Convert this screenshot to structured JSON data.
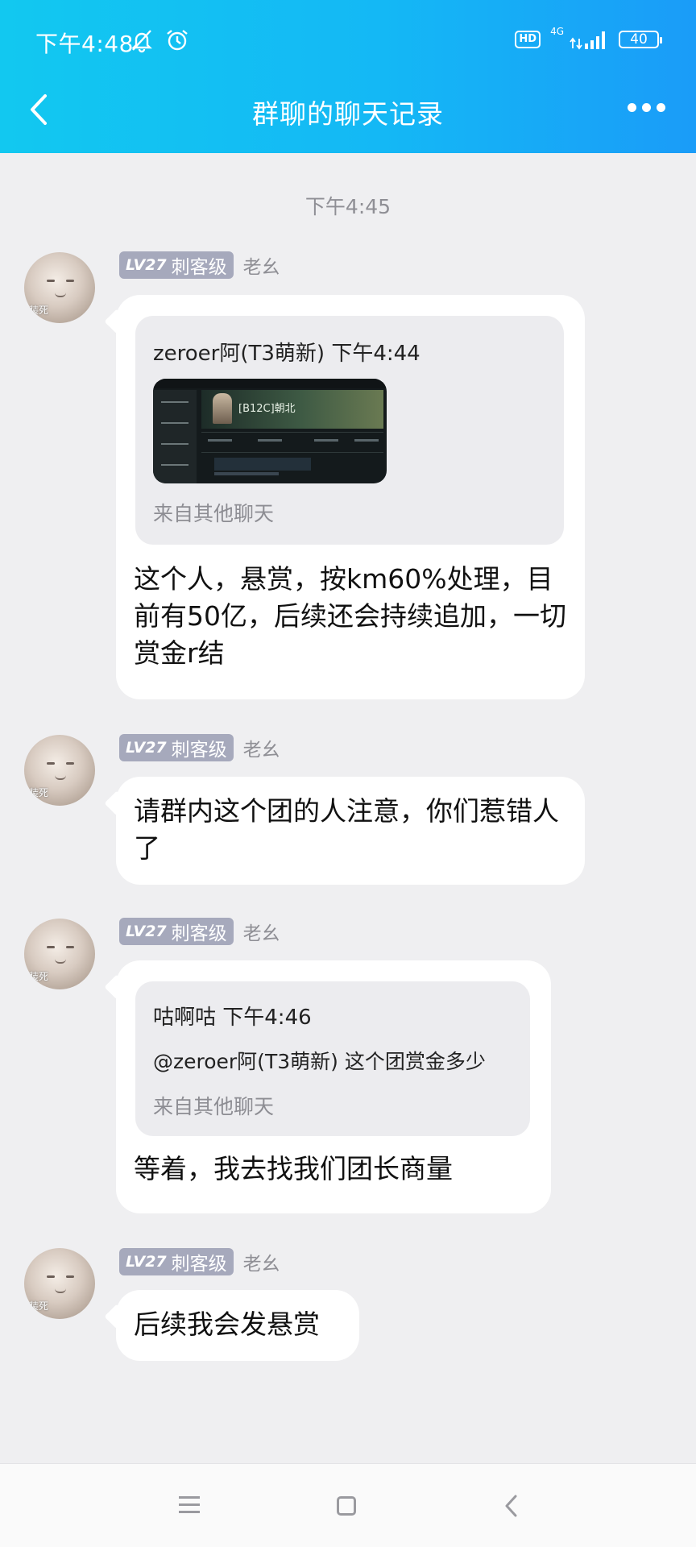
{
  "status_bar": {
    "time": "下午4:48",
    "hd": "HD",
    "network": "4G",
    "battery": "40"
  },
  "header": {
    "title": "群聊的聊天记录"
  },
  "chat": {
    "timestamp": "下午4:45",
    "sender": {
      "level": "LV27",
      "title": "刺客级",
      "name": "老幺",
      "avatar_tag": "装死"
    },
    "messages": [
      {
        "forward": {
          "head": "zeroer阿(T3萌新) 下午4:44",
          "thumb_text": "[B12C]朝北",
          "source": "来自其他聊天"
        },
        "text": "这个人，悬赏，按km60%处理，目前有50亿，后续还会持续追加，一切赏金r结"
      },
      {
        "text": "请群内这个团的人注意，你们惹错人了"
      },
      {
        "forward": {
          "head": "咕啊咕 下午4:46",
          "line": "@zeroer阿(T3萌新) 这个团赏金多少",
          "source": "来自其他聊天"
        },
        "text": "等着，我去找我们团长商量"
      },
      {
        "text": "后续我会发悬赏"
      }
    ]
  },
  "colors": {
    "header_start": "#12c8f0",
    "header_end": "#1a9cf8",
    "badge": "#a6a9bc",
    "background": "#efeff1"
  },
  "icons": [
    "back-arrow-icon",
    "more-dots-icon",
    "mute-bell-icon",
    "alarm-icon",
    "signal-icon",
    "battery-icon",
    "menu-icon",
    "home-icon",
    "back-nav-icon"
  ]
}
